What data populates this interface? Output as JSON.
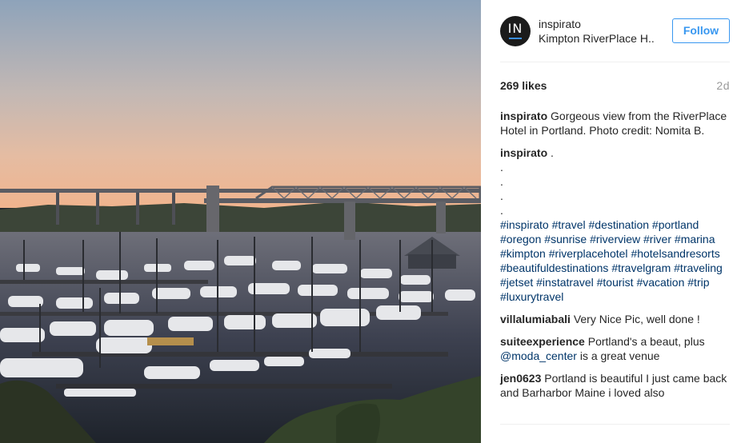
{
  "header": {
    "avatar_initials": "IN",
    "username": "inspirato",
    "location": "Kimpton RiverPlace H..",
    "follow_label": "Follow"
  },
  "stats": {
    "likes": "269 likes",
    "age": "2d"
  },
  "caption": {
    "username": "inspirato",
    "text": "Gorgeous view from the RiverPlace Hotel in Portland. Photo credit: Nomita B."
  },
  "hashtag_comment": {
    "username": "inspirato",
    "lead": ".",
    "dots": [
      ".",
      ".",
      ".",
      "."
    ],
    "tags": [
      "#inspirato",
      "#travel",
      "#destination",
      "#portland",
      "#oregon",
      "#sunrise",
      "#riverview",
      "#river",
      "#marina",
      "#kimpton",
      "#riverplacehotel",
      "#hotelsandresorts",
      "#beautifuldestinations",
      "#travelgram",
      "#traveling",
      "#jetset",
      "#instatravel",
      "#tourist",
      "#vacation",
      "#trip",
      "#luxurytravel"
    ]
  },
  "comments": [
    {
      "username": "villalumiabali",
      "pre": "Very Nice Pic, well done !",
      "mention": "",
      "post": ""
    },
    {
      "username": "suiteexperience",
      "pre": "Portland's a beaut, plus",
      "mention": "@moda_center",
      "post": "is a great venue"
    },
    {
      "username": "jen0623",
      "pre": "Portland is beautiful I just came back and Barharbor Maine i loved also",
      "mention": "",
      "post": ""
    }
  ],
  "colors": {
    "link": "#003569",
    "follow": "#3897f0",
    "muted": "#999999"
  }
}
